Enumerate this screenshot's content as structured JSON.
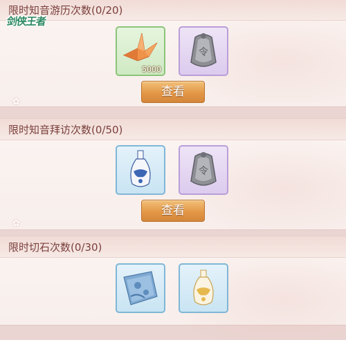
{
  "logo": {
    "text": "剑侠王者"
  },
  "sections": [
    {
      "title": "限时知音游历次数(0/20)",
      "items": [
        {
          "name": "paper-crane",
          "qty": "5000"
        },
        {
          "name": "silver-token",
          "qty": ""
        }
      ],
      "button": "查看"
    },
    {
      "title": "限时知音拜访次数(0/50)",
      "items": [
        {
          "name": "porcelain-vase",
          "qty": ""
        },
        {
          "name": "silver-token",
          "qty": ""
        }
      ],
      "button": "查看"
    },
    {
      "title": "限时切石次数(0/30)",
      "items": [
        {
          "name": "blue-cloth",
          "qty": ""
        },
        {
          "name": "gold-vase",
          "qty": ""
        }
      ]
    }
  ],
  "colors": {
    "title_text": "#7a3f3b",
    "button": "#e39846",
    "frame_green": "#8cc37a",
    "frame_purple": "#b99ed9",
    "frame_blue": "#7fb6d6"
  }
}
